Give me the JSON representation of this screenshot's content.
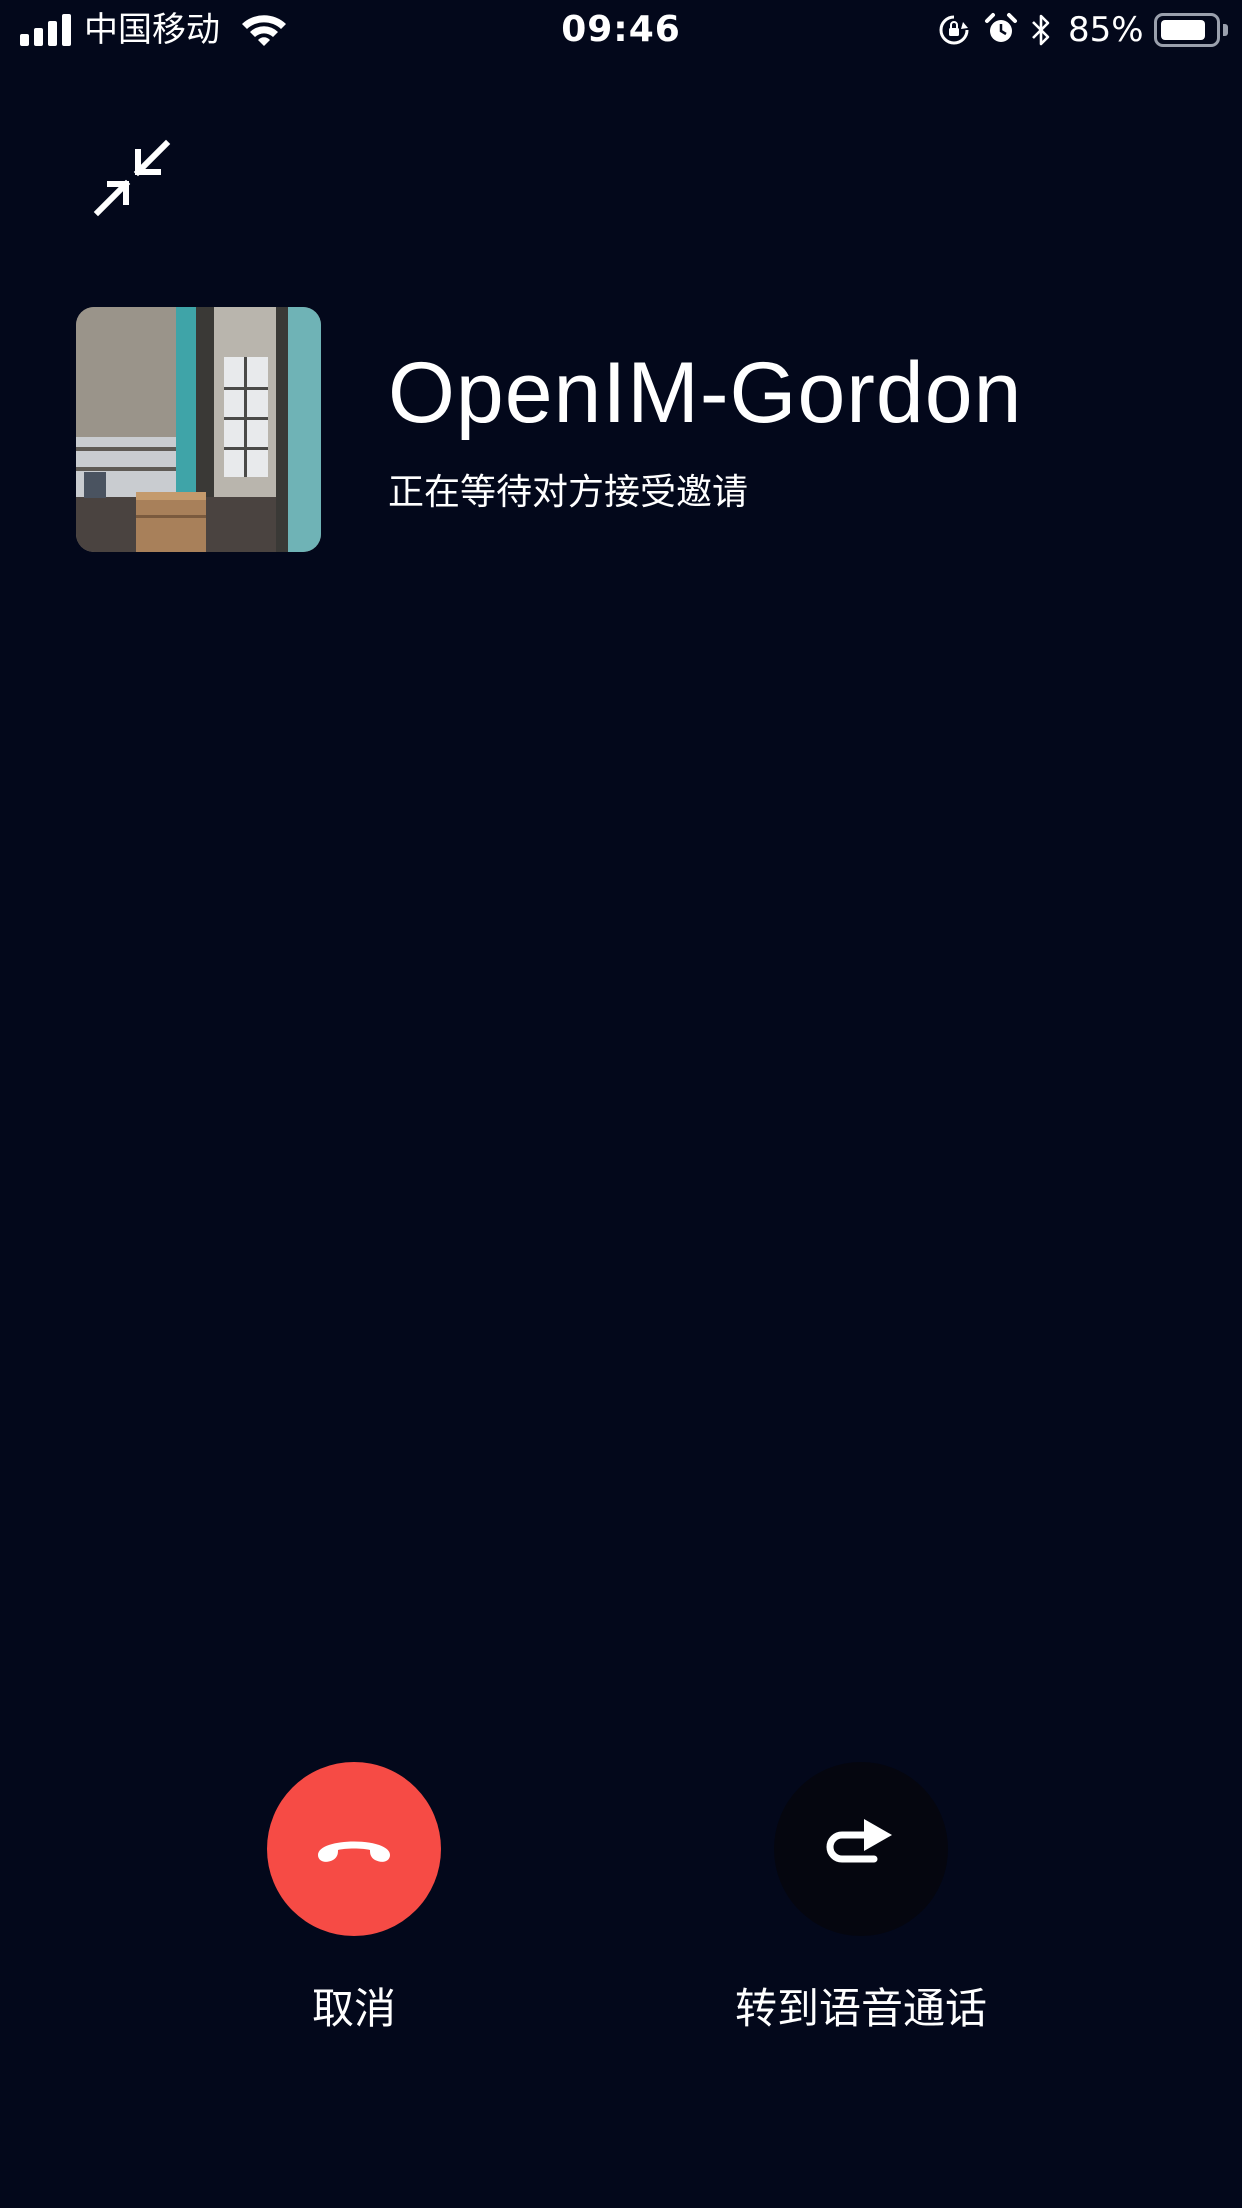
{
  "status_bar": {
    "carrier": "中国移动",
    "time": "09:46",
    "battery_percent": "85%",
    "battery_level": 0.85,
    "icons": [
      "signal-icon",
      "wifi-icon",
      "rotation-lock-icon",
      "alarm-icon",
      "bluetooth-icon",
      "battery-icon"
    ]
  },
  "call": {
    "caller_name": "OpenIM-Gordon",
    "status": "正在等待对方接受邀请",
    "minimize_icon": "minimize-icon",
    "avatar": "caller-avatar"
  },
  "actions": {
    "cancel_label": "取消",
    "cancel_icon": "hang-up-icon",
    "switch_label": "转到语音通话",
    "switch_icon": "switch-arrow-icon"
  },
  "colors": {
    "background": "#03081b",
    "cancel_button": "#f64b45",
    "switch_button": "#05060f",
    "text": "#ffffff"
  }
}
